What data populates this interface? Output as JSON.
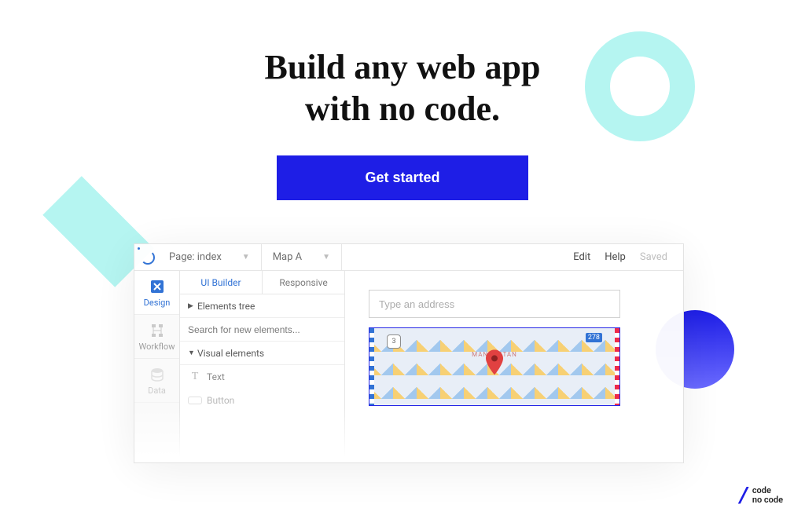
{
  "hero": {
    "title_line1": "Build any web app",
    "title_line2": "with no code.",
    "cta_label": "Get started"
  },
  "editor": {
    "page_label": "Page: index",
    "element_label": "Map A",
    "edit_label": "Edit",
    "help_label": "Help",
    "saved_label": "Saved"
  },
  "rail": {
    "design": "Design",
    "workflow": "Workflow",
    "data": "Data"
  },
  "panel": {
    "tab_ui": "UI Builder",
    "tab_responsive": "Responsive",
    "elements_tree": "Elements tree",
    "search_placeholder": "Search for new elements...",
    "visual_elements": "Visual elements",
    "item_text": "Text",
    "item_button": "Button"
  },
  "canvas": {
    "address_placeholder": "Type an address",
    "route_badge": "3",
    "route_badge2": "278",
    "map_label": "MANHATTAN"
  },
  "footer": {
    "line1": "code",
    "line2": "no code"
  }
}
